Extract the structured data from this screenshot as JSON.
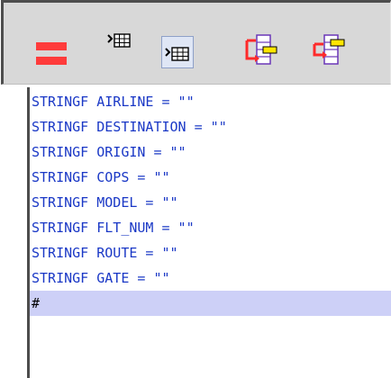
{
  "toolbar": {
    "icons": [
      {
        "name": "equals-icon",
        "color": "#ff3b3b"
      },
      {
        "name": "table-arrow-icon"
      },
      {
        "name": "table-arrow-boxed-icon"
      },
      {
        "name": "flow-table-red-icon"
      },
      {
        "name": "flow-table-red-2-icon"
      }
    ]
  },
  "editor": {
    "lines": [
      "STRINGF AIRLINE = \"\"",
      "STRINGF DESTINATION = \"\"",
      "STRINGF ORIGIN = \"\"",
      "STRINGF COPS = \"\"",
      "STRINGF MODEL = \"\"",
      "STRINGF FLT_NUM = \"\"",
      "STRINGF ROUTE = \"\"",
      "STRINGF GATE = \"\"",
      "#"
    ],
    "active_line_index": 8,
    "text_color": "#1a38c6",
    "highlight_color": "#cdd0f7"
  }
}
